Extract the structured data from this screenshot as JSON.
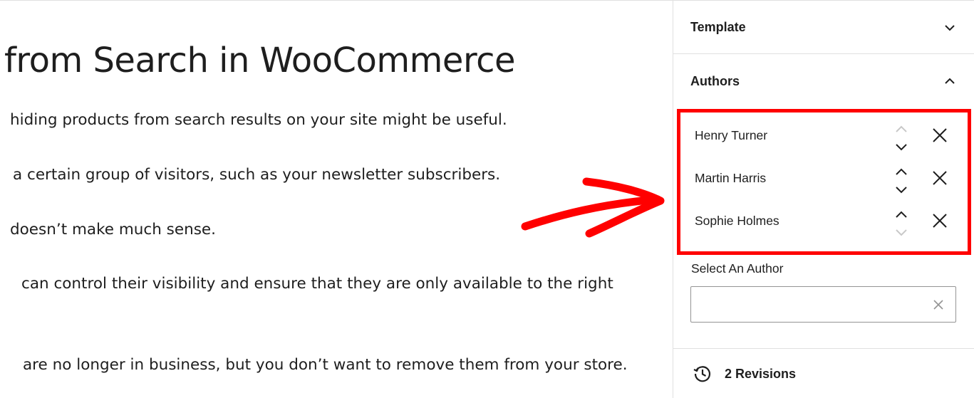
{
  "editor": {
    "title": "from Search in WooCommerce",
    "paragraphs": [
      "hiding products from search results on your site might be useful.",
      "a certain group of visitors, such as your newsletter subscribers.",
      "doesn’t make much sense.",
      "can control their visibility and ensure that they are only available to the right",
      "are no longer in business, but you don’t want to remove them from your store."
    ]
  },
  "sidebar": {
    "template_panel": {
      "label": "Template",
      "icon": "chevron-down-icon",
      "expanded": false
    },
    "authors_panel": {
      "label": "Authors",
      "icon": "chevron-up-icon",
      "expanded": true,
      "authors": [
        {
          "name": "Henry Turner",
          "move_up_enabled": false,
          "move_down_enabled": true
        },
        {
          "name": "Martin Harris",
          "move_up_enabled": true,
          "move_down_enabled": true
        },
        {
          "name": "Sophie Holmes",
          "move_up_enabled": true,
          "move_down_enabled": false
        }
      ],
      "select_label": "Select An Author",
      "select_value": "",
      "select_placeholder": ""
    },
    "revisions": {
      "label": "2 Revisions",
      "icon": "history-icon"
    }
  },
  "colors": {
    "highlight": "#ff0000",
    "text": "#1e1e1e",
    "disabled_icon": "#c8c8c8",
    "border": "#e0e0e0"
  }
}
